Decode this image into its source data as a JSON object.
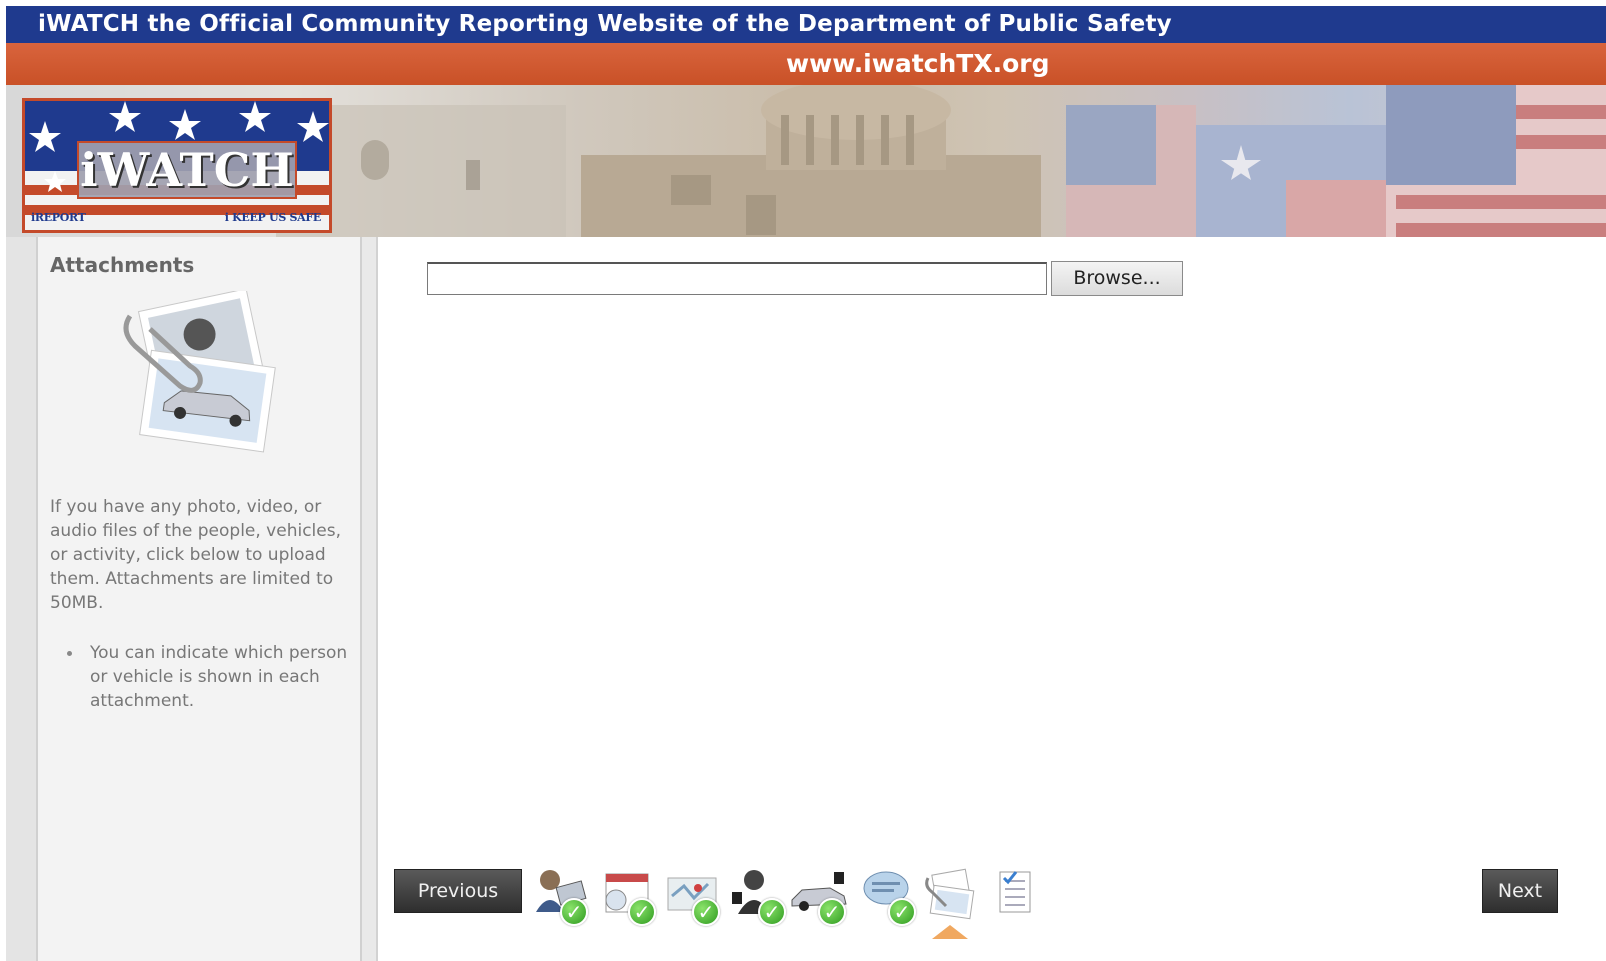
{
  "header": {
    "brand": "iWATCH",
    "title_rest": "the Official Community Reporting Website of the Department of Public Safety",
    "url": "www.iwatchTX.org"
  },
  "logo": {
    "title": "iWATCH",
    "left_tag": "iREPORT",
    "right_tag": "i KEEP US SAFE"
  },
  "sidebar": {
    "heading": "Attachments",
    "description": "If you have any photo, video, or audio files of the people, vehicles, or activity, click below to upload them. Attachments are limited to 50MB.",
    "bullets": [
      "You can indicate which person or vehicle is shown in each attachment."
    ]
  },
  "form": {
    "file_value": "",
    "browse_label": "Browse..."
  },
  "nav": {
    "previous_label": "Previous",
    "next_label": "Next"
  },
  "steps": [
    {
      "name": "reporter-step-icon",
      "completed": true
    },
    {
      "name": "calendar-step-icon",
      "completed": true
    },
    {
      "name": "location-map-step-icon",
      "completed": true
    },
    {
      "name": "person-step-icon",
      "completed": true
    },
    {
      "name": "vehicle-step-icon",
      "completed": true
    },
    {
      "name": "description-step-icon",
      "completed": true
    },
    {
      "name": "attachments-step-icon",
      "completed": false,
      "current": true
    },
    {
      "name": "review-checklist-step-icon",
      "completed": false
    }
  ],
  "colors": {
    "header_blue": "#1f3a8e",
    "header_orange": "#c95127",
    "check_green": "#2d9a1e"
  }
}
